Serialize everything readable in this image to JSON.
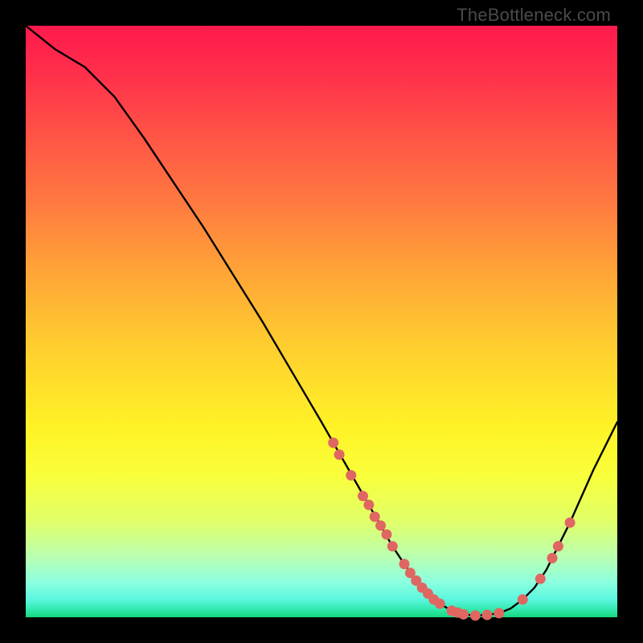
{
  "watermark": {
    "text": "TheBottleneck.com"
  },
  "chart_data": {
    "type": "line",
    "title": "",
    "xlabel": "",
    "ylabel": "",
    "xlim": [
      0,
      100
    ],
    "ylim": [
      0,
      100
    ],
    "grid": false,
    "legend": false,
    "curve_color": "#000000",
    "point_color": "#e06662",
    "series": [
      {
        "name": "bottleneck-curve",
        "x": [
          0,
          5,
          10,
          15,
          20,
          25,
          30,
          35,
          40,
          45,
          50,
          52,
          54,
          56,
          58,
          60,
          62,
          64,
          66,
          68,
          70,
          72,
          74,
          76,
          78,
          80,
          82,
          84,
          86,
          88,
          90,
          92,
          94,
          96,
          98,
          100
        ],
        "y": [
          100,
          96,
          93,
          88,
          81,
          73.5,
          66,
          58,
          50,
          41.5,
          33,
          29.5,
          26,
          22.5,
          19,
          15.5,
          12,
          9,
          6.2,
          4,
          2.3,
          1.1,
          0.5,
          0.3,
          0.4,
          0.7,
          1.5,
          3,
          5,
          8,
          12,
          16,
          20.5,
          25,
          29,
          33
        ]
      }
    ],
    "points": [
      {
        "x": 52,
        "y": 29.5
      },
      {
        "x": 53,
        "y": 27.5
      },
      {
        "x": 55,
        "y": 24
      },
      {
        "x": 57,
        "y": 20.5
      },
      {
        "x": 58,
        "y": 19
      },
      {
        "x": 59,
        "y": 17
      },
      {
        "x": 60,
        "y": 15.5
      },
      {
        "x": 61,
        "y": 14
      },
      {
        "x": 62,
        "y": 12
      },
      {
        "x": 64,
        "y": 9
      },
      {
        "x": 65,
        "y": 7.5
      },
      {
        "x": 66,
        "y": 6.2
      },
      {
        "x": 67,
        "y": 5
      },
      {
        "x": 68,
        "y": 4
      },
      {
        "x": 69,
        "y": 3
      },
      {
        "x": 70,
        "y": 2.3
      },
      {
        "x": 72,
        "y": 1.1
      },
      {
        "x": 73,
        "y": 0.8
      },
      {
        "x": 74,
        "y": 0.5
      },
      {
        "x": 76,
        "y": 0.3
      },
      {
        "x": 78,
        "y": 0.4
      },
      {
        "x": 80,
        "y": 0.7
      },
      {
        "x": 84,
        "y": 3
      },
      {
        "x": 87,
        "y": 6.5
      },
      {
        "x": 89,
        "y": 10
      },
      {
        "x": 90,
        "y": 12
      },
      {
        "x": 92,
        "y": 16
      }
    ]
  }
}
